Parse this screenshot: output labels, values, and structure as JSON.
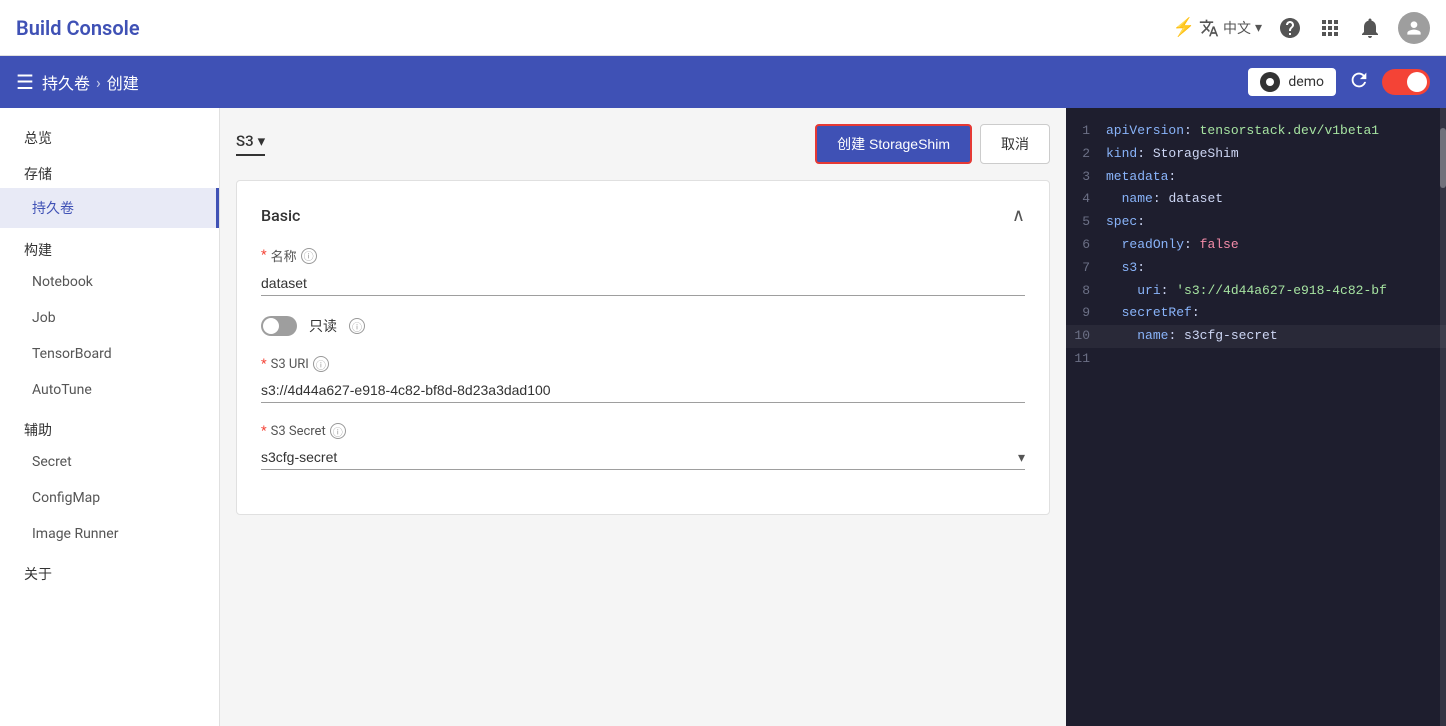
{
  "header": {
    "title": "Build Console",
    "lang": "中文",
    "icons": {
      "translate": "⚙",
      "help": "?",
      "apps": "⋮⋮",
      "bell": "🔔",
      "avatar": "👤"
    }
  },
  "subheader": {
    "menu_icon": "☰",
    "breadcrumb": {
      "parent": "持久卷",
      "separator": ">",
      "current": "创建"
    },
    "cluster": {
      "name": "demo"
    },
    "refresh_label": "刷新"
  },
  "sidebar": {
    "sections": [
      {
        "title": "总览",
        "items": []
      },
      {
        "title": "存储",
        "items": [
          {
            "label": "持久卷",
            "active": true
          }
        ]
      },
      {
        "title": "构建",
        "items": [
          {
            "label": "Notebook",
            "active": false
          },
          {
            "label": "Job",
            "active": false
          },
          {
            "label": "TensorBoard",
            "active": false
          },
          {
            "label": "AutoTune",
            "active": false
          }
        ]
      },
      {
        "title": "辅助",
        "items": [
          {
            "label": "Secret",
            "active": false
          },
          {
            "label": "ConfigMap",
            "active": false
          },
          {
            "label": "Image Runner",
            "active": false
          }
        ]
      },
      {
        "title": "关于",
        "items": []
      }
    ]
  },
  "form": {
    "storage_type": "S3",
    "create_button": "创建 StorageShim",
    "cancel_button": "取消",
    "section_title": "Basic",
    "fields": {
      "name_label": "名称",
      "name_value": "dataset",
      "readonly_label": "只读",
      "s3uri_label": "S3 URI",
      "s3uri_value": "s3://4d44a627-e918-4c82-bf8d-8d23a3dad100",
      "s3secret_label": "S3 Secret",
      "s3secret_value": "s3cfg-secret"
    }
  },
  "code": {
    "lines": [
      {
        "num": 1,
        "content": "apiVersion: tensorstack.dev/v1beta1"
      },
      {
        "num": 2,
        "content": "kind: StorageShim"
      },
      {
        "num": 3,
        "content": "metadata:"
      },
      {
        "num": 4,
        "content": "  name: dataset"
      },
      {
        "num": 5,
        "content": "spec:"
      },
      {
        "num": 6,
        "content": "  readOnly: false"
      },
      {
        "num": 7,
        "content": "  s3:"
      },
      {
        "num": 8,
        "content": "    uri: 's3://4d44a627-e918-4c82-bf"
      },
      {
        "num": 9,
        "content": "  secretRef:"
      },
      {
        "num": 10,
        "content": "    name: s3cfg-secret"
      },
      {
        "num": 11,
        "content": ""
      }
    ]
  }
}
